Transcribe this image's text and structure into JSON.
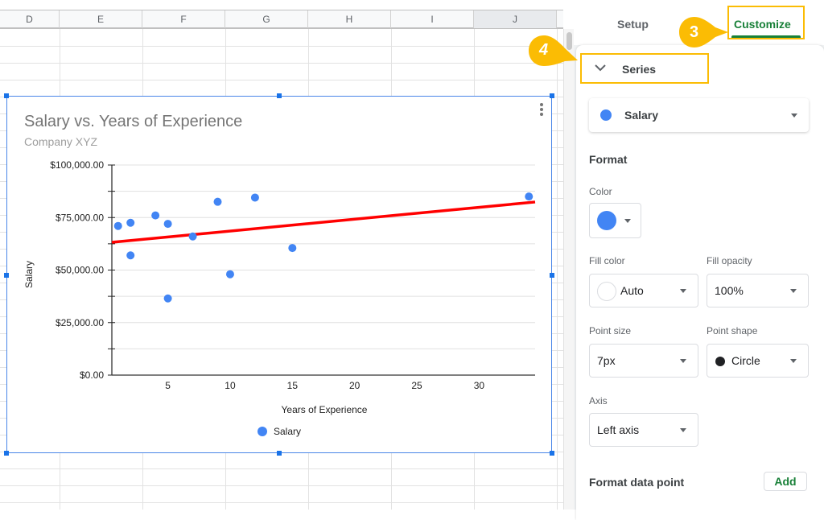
{
  "sheet": {
    "columns": [
      "D",
      "E",
      "F",
      "G",
      "H",
      "I",
      "J"
    ],
    "selected_column": "J"
  },
  "chart_data": {
    "type": "scatter",
    "title": "Salary vs. Years of Experience",
    "subtitle": "Company XYZ",
    "xlabel": "Years of Experience",
    "ylabel": "Salary",
    "xlim": [
      0.5,
      34.5
    ],
    "ylim": [
      0,
      100000
    ],
    "x_ticks": [
      5,
      10,
      15,
      20,
      25,
      30
    ],
    "y_ticks": [
      0,
      25000,
      50000,
      75000,
      100000
    ],
    "y_tick_labels": [
      "$0.00",
      "$25,000.00",
      "$50,000.00",
      "$75,000.00",
      "$100,000.00"
    ],
    "grid": true,
    "legend": "bottom",
    "series": [
      {
        "name": "Salary",
        "color": "#4285f4",
        "points": [
          {
            "x": 1,
            "y": 71000
          },
          {
            "x": 2,
            "y": 72500
          },
          {
            "x": 2,
            "y": 57000
          },
          {
            "x": 4,
            "y": 76000
          },
          {
            "x": 5,
            "y": 72000
          },
          {
            "x": 5,
            "y": 36500
          },
          {
            "x": 7,
            "y": 66000
          },
          {
            "x": 9,
            "y": 82500
          },
          {
            "x": 10,
            "y": 48000
          },
          {
            "x": 12,
            "y": 84500
          },
          {
            "x": 15,
            "y": 60500
          },
          {
            "x": 34,
            "y": 85000
          }
        ]
      }
    ],
    "trendline": {
      "type": "linear",
      "color": "#ff0000",
      "start": {
        "x": 0.5,
        "y": 63200
      },
      "end": {
        "x": 34.5,
        "y": 82400
      }
    }
  },
  "panel": {
    "tabs": {
      "setup": "Setup",
      "customize": "Customize",
      "active": "customize"
    },
    "section": "Series",
    "series_select": "Salary",
    "format_title": "Format",
    "color_label": "Color",
    "color_value": "#4285f4",
    "fill_color_label": "Fill color",
    "fill_color_value": "Auto",
    "fill_opacity_label": "Fill opacity",
    "fill_opacity_value": "100%",
    "point_size_label": "Point size",
    "point_size_value": "7px",
    "point_shape_label": "Point shape",
    "point_shape_value": "Circle",
    "axis_label": "Axis",
    "axis_value": "Left axis",
    "format_data_point_label": "Format data point",
    "add_label": "Add"
  },
  "callouts": [
    {
      "number": "3",
      "target": "Customize tab"
    },
    {
      "number": "4",
      "target": "Series section"
    }
  ],
  "accent_colors": {
    "highlight": "#fbbc04",
    "active_tab": "#188038",
    "selection": "#1a73e8"
  }
}
